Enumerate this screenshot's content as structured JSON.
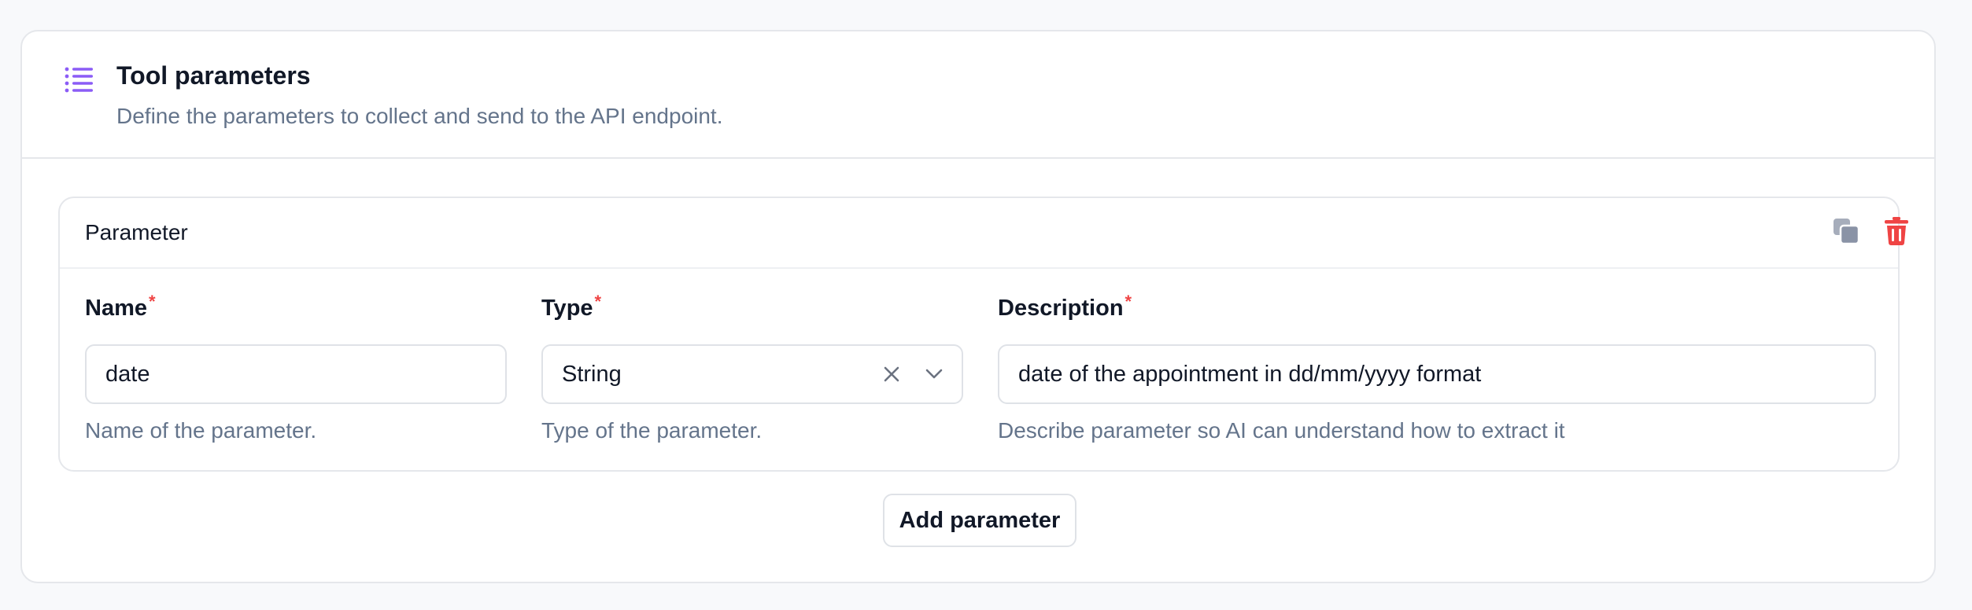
{
  "header": {
    "icon": "list-icon",
    "title": "Tool parameters",
    "description": "Define the parameters to collect and send to the API endpoint."
  },
  "parameter": {
    "title": "Parameter",
    "actions": {
      "copy_icon": "copy-icon",
      "delete_icon": "trash-icon"
    },
    "fields": {
      "name": {
        "label": "Name",
        "required": "*",
        "value": "date",
        "help": "Name of the parameter."
      },
      "type": {
        "label": "Type",
        "required": "*",
        "value": "String",
        "help": "Type of the parameter."
      },
      "description": {
        "label": "Description",
        "required": "*",
        "value": "date of the appointment in dd/mm/yyyy format",
        "help": "Describe parameter so AI can understand how to extract it"
      }
    }
  },
  "add_button": {
    "label": "Add parameter"
  },
  "colors": {
    "accent": "#8b5cf6",
    "danger": "#ef4444",
    "muted": "#64748b",
    "border": "#e5e7eb"
  }
}
